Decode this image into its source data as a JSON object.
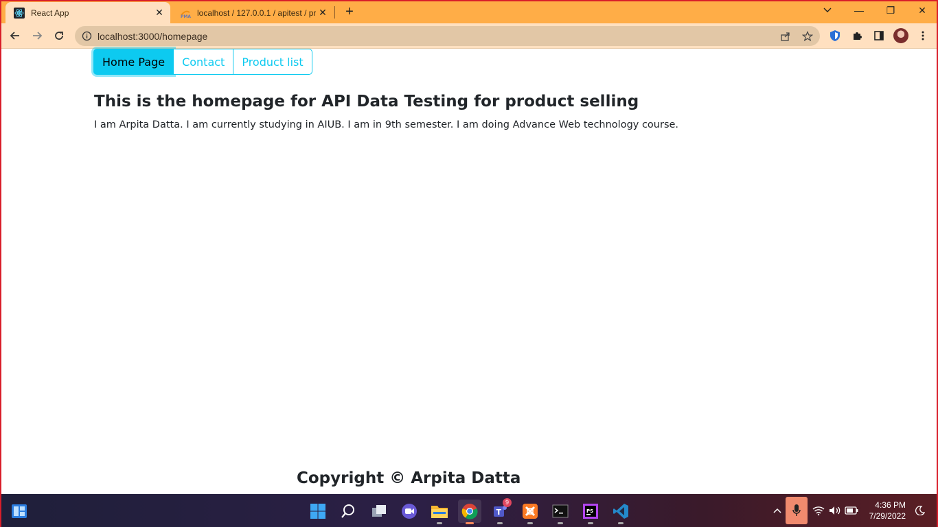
{
  "browser": {
    "tabs": [
      {
        "title": "React App",
        "active": true
      },
      {
        "title": "localhost / 127.0.0.1 / apitest / pr",
        "active": false
      }
    ],
    "new_tab_label": "+",
    "url": "localhost:3000/homepage",
    "window_controls": {
      "minimize": "—",
      "restore": "❐",
      "close": "✕"
    }
  },
  "nav": {
    "buttons": [
      "Home Page",
      "Contact",
      "Product list"
    ]
  },
  "content": {
    "heading": "This is the homepage for API Data Testing for product selling",
    "paragraph": "I am Arpita Datta. I am currently studying in AIUB. I am in 9th semester. I am doing Advance Web technology course.",
    "footer": "Copyright © Arpita Datta"
  },
  "taskbar": {
    "teams_badge": "9",
    "time": "4:36 PM",
    "date": "7/29/2022"
  },
  "colors": {
    "tabstrip": "#ffad47",
    "toolbar": "#ffe0c0",
    "accent": "#0dcaf0",
    "frame": "#d91e2a"
  }
}
